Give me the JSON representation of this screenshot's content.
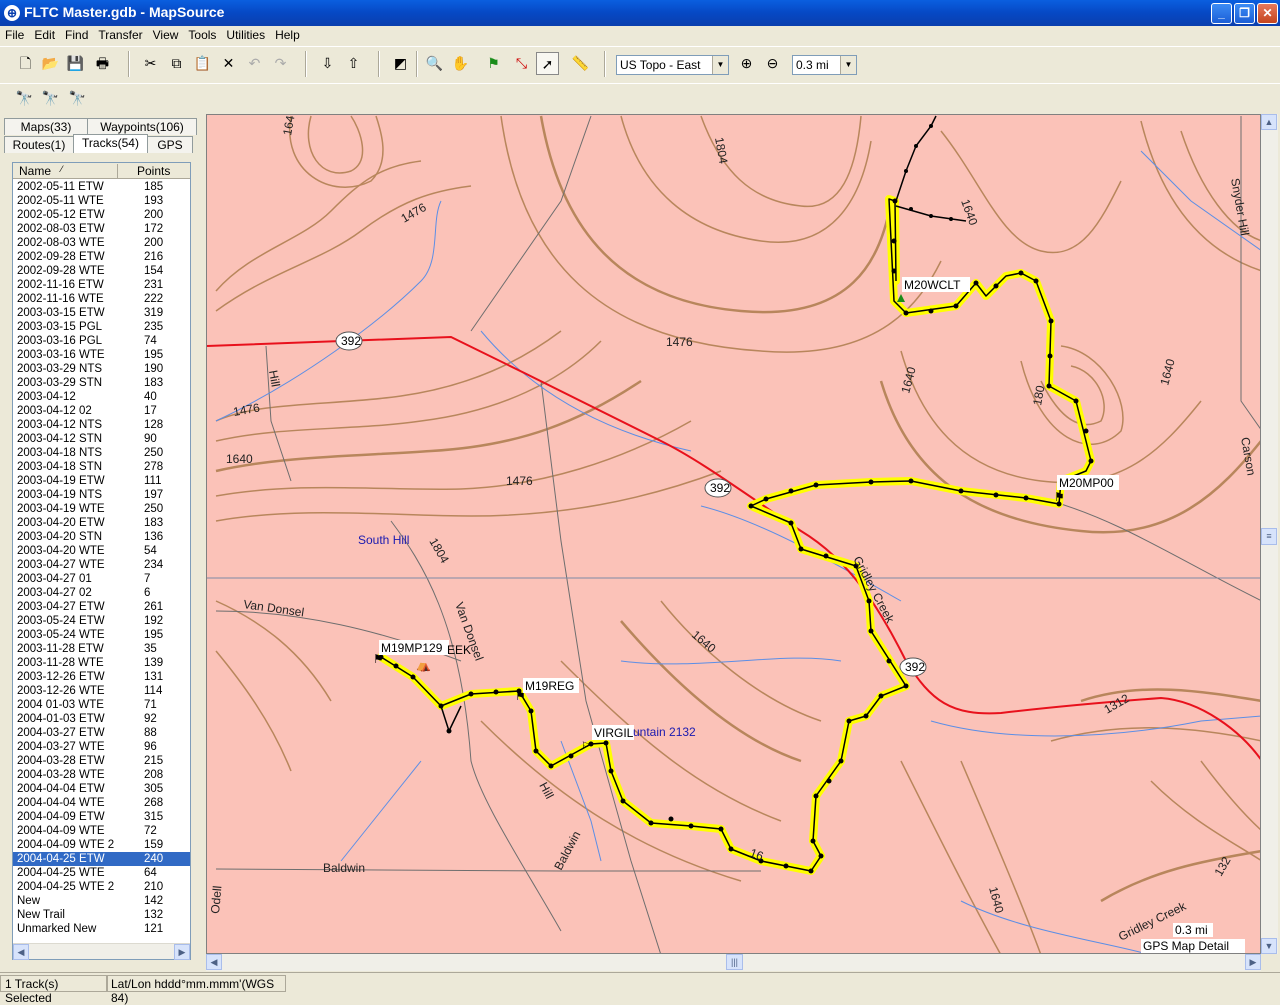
{
  "window": {
    "title": "FLTC Master.gdb - MapSource"
  },
  "menu": [
    "File",
    "Edit",
    "Find",
    "Transfer",
    "View",
    "Tools",
    "Utilities",
    "Help"
  ],
  "toolbar": {
    "map_product": "US Topo - East",
    "zoom_scale": "0.3 mi",
    "icons": [
      "new-icon",
      "open-icon",
      "save-icon",
      "print-icon",
      "cut-icon",
      "copy-icon",
      "paste-icon",
      "delete-icon",
      "undo-icon",
      "redo-icon",
      "receive-from-device-icon",
      "send-to-device-icon",
      "map-tool-icon",
      "zoom-tool-icon",
      "hand-tool-icon",
      "waypoint-tool-icon",
      "route-tool-icon",
      "selection-tool-icon",
      "distance-tool-icon",
      "zoom-in-icon",
      "zoom-out-icon",
      "find-icon",
      "find-nearest-icon",
      "find-places-icon"
    ]
  },
  "tabs": {
    "maps": "Maps(33)",
    "waypoints": "Waypoints(106)",
    "routes": "Routes(1)",
    "tracks": "Tracks(54)",
    "gps": "GPS"
  },
  "tracks_list": {
    "columns": [
      "Name",
      "Points"
    ],
    "rows": [
      {
        "name": "2002-05-11 ETW",
        "points": "185"
      },
      {
        "name": "2002-05-11 WTE",
        "points": "193"
      },
      {
        "name": "2002-05-12 ETW",
        "points": "200"
      },
      {
        "name": "2002-08-03 ETW",
        "points": "172"
      },
      {
        "name": "2002-08-03 WTE",
        "points": "200"
      },
      {
        "name": "2002-09-28 ETW",
        "points": "216"
      },
      {
        "name": "2002-09-28 WTE",
        "points": "154"
      },
      {
        "name": "2002-11-16 ETW",
        "points": "231"
      },
      {
        "name": "2002-11-16 WTE",
        "points": "222"
      },
      {
        "name": "2003-03-15 ETW",
        "points": "319"
      },
      {
        "name": "2003-03-15 PGL",
        "points": "235"
      },
      {
        "name": "2003-03-16 PGL",
        "points": "74"
      },
      {
        "name": "2003-03-16 WTE",
        "points": "195"
      },
      {
        "name": "2003-03-29 NTS",
        "points": "190"
      },
      {
        "name": "2003-03-29 STN",
        "points": "183"
      },
      {
        "name": "2003-04-12",
        "points": "40"
      },
      {
        "name": "2003-04-12 02",
        "points": "17"
      },
      {
        "name": "2003-04-12 NTS",
        "points": "128"
      },
      {
        "name": "2003-04-12 STN",
        "points": "90"
      },
      {
        "name": "2003-04-18 NTS",
        "points": "250"
      },
      {
        "name": "2003-04-18 STN",
        "points": "278"
      },
      {
        "name": "2003-04-19 ETW",
        "points": "111"
      },
      {
        "name": "2003-04-19 NTS",
        "points": "197"
      },
      {
        "name": "2003-04-19 WTE",
        "points": "250"
      },
      {
        "name": "2003-04-20 ETW",
        "points": "183"
      },
      {
        "name": "2003-04-20 STN",
        "points": "136"
      },
      {
        "name": "2003-04-20 WTE",
        "points": "54"
      },
      {
        "name": "2003-04-27  WTE",
        "points": "234"
      },
      {
        "name": "2003-04-27 01",
        "points": "7"
      },
      {
        "name": "2003-04-27 02",
        "points": "6"
      },
      {
        "name": "2003-04-27 ETW",
        "points": "261"
      },
      {
        "name": "2003-05-24 ETW",
        "points": "192"
      },
      {
        "name": "2003-05-24 WTE",
        "points": "195"
      },
      {
        "name": "2003-11-28 ETW",
        "points": "35"
      },
      {
        "name": "2003-11-28 WTE",
        "points": "139"
      },
      {
        "name": "2003-12-26 ETW",
        "points": "131"
      },
      {
        "name": "2003-12-26 WTE",
        "points": "114"
      },
      {
        "name": "2004 01-03 WTE",
        "points": "71"
      },
      {
        "name": "2004-01-03 ETW",
        "points": "92"
      },
      {
        "name": "2004-03-27 ETW",
        "points": "88"
      },
      {
        "name": "2004-03-27 WTE",
        "points": "96"
      },
      {
        "name": "2004-03-28 ETW",
        "points": "215"
      },
      {
        "name": "2004-03-28 WTE",
        "points": "208"
      },
      {
        "name": "2004-04-04 ETW",
        "points": "305"
      },
      {
        "name": "2004-04-04 WTE",
        "points": "268"
      },
      {
        "name": "2004-04-09 ETW",
        "points": "315"
      },
      {
        "name": "2004-04-09 WTE",
        "points": "72"
      },
      {
        "name": "2004-04-09 WTE 2",
        "points": "159"
      },
      {
        "name": "2004-04-25 ETW",
        "points": "240",
        "selected": true
      },
      {
        "name": "2004-04-25 WTE",
        "points": "64"
      },
      {
        "name": "2004-04-25 WTE 2",
        "points": "210"
      },
      {
        "name": "New",
        "points": "142"
      },
      {
        "name": "New Trail",
        "points": "132"
      },
      {
        "name": "Unmarked New",
        "points": "121"
      }
    ]
  },
  "map": {
    "colors": {
      "land": "#fbc2b8",
      "contour": "#b8865c",
      "highway": "#e8111c",
      "stream": "#5b8ee6",
      "track_highlight": "#ffff00",
      "grid": "#7e8aa6"
    },
    "waypoints": [
      "M20WCLT",
      "M20MP00",
      "M19MP129",
      "M19REG",
      "VIRGIL",
      "EEK"
    ],
    "road_shields": [
      "392",
      "392",
      "392"
    ],
    "labels": {
      "south_hill": "South Hill",
      "van_donsel": "Van Donsel",
      "van_donsel_2": "Van Donsel",
      "baldwin": "Baldwin",
      "baldwin_2": "Baldwin",
      "odell": "Odell",
      "gridley_creek": "Gridley Creek",
      "gridley_creek_2": "Gridley Creek",
      "snyder_hill": "Snyder Hill",
      "carson": "Carson",
      "hill": "Hill",
      "hill_2": "Hill",
      "mountain": "untain 2132",
      "e1476_a": "1476",
      "e1476_b": "1476",
      "e1476_c": "1476",
      "e1476_d": "1476",
      "e1640_a": "1640",
      "e1640_b": "1640",
      "e1640_c": "1640",
      "e1640_d": "1640",
      "e1640_e": "1640",
      "e1640_f": "1640",
      "e1640_g": "1640",
      "e1804_a": "1804",
      "e1804_b": "1804",
      "e1312": "1312",
      "e132": "132",
      "e180": "180",
      "e164": "164",
      "e16": "16"
    },
    "scale_text": "0.3 mi",
    "detail_text": "GPS Map Detail"
  },
  "status": {
    "selection": "1 Track(s) Selected",
    "position_format": "Lat/Lon hddd°mm.mmm'(WGS 84)"
  }
}
